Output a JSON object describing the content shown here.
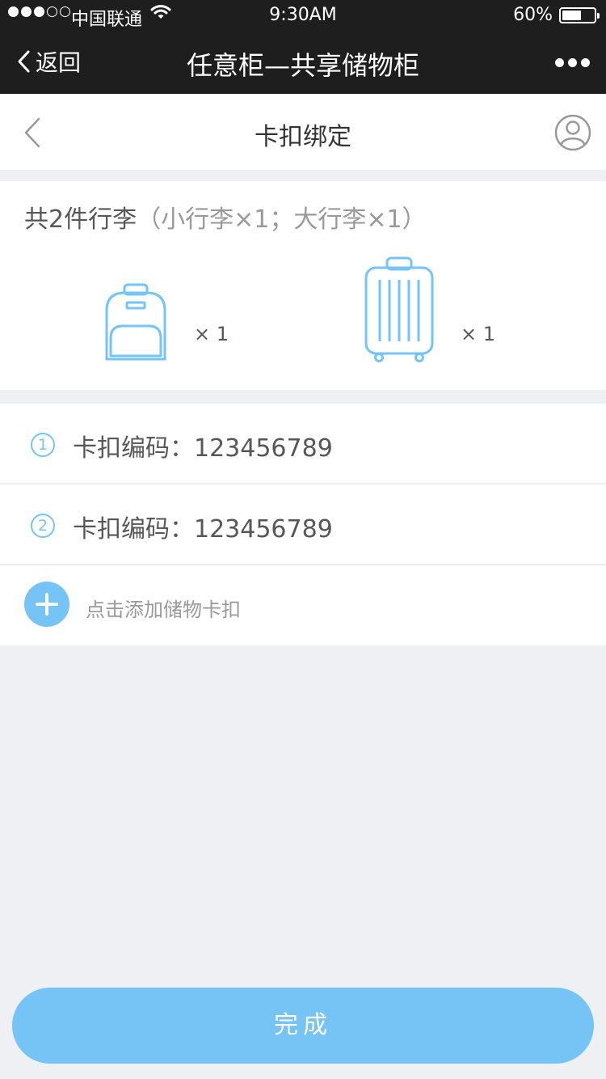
{
  "status_bar": {
    "carrier": "中国联通",
    "time": "9:30AM",
    "battery_percent_text": "60%",
    "battery_level": 0.6,
    "signal_bars_filled": 3,
    "signal_bars_total": 5
  },
  "title_bar": {
    "back_label": "返回",
    "title": "任意柜—共享储物柜"
  },
  "page_header": {
    "title": "卡扣绑定"
  },
  "luggage": {
    "summary_main": "共2件行李",
    "summary_detail": "（小行李×1；大行李×1）",
    "items": [
      {
        "icon": "backpack-icon",
        "quantity": "× 1"
      },
      {
        "icon": "suitcase-icon",
        "quantity": "× 1"
      }
    ]
  },
  "buckles": [
    {
      "index": "1",
      "label": "卡扣编码：123456789"
    },
    {
      "index": "2",
      "label": "卡扣编码：123456789"
    }
  ],
  "add_buckle": {
    "label": "点击添加储物卡扣"
  },
  "done_button": {
    "label": "完成"
  },
  "colors": {
    "accent": "#76C3F6",
    "text_primary": "#575757",
    "text_secondary": "#999999",
    "background": "#EFF0F4",
    "topbar": "#1E1E1E"
  }
}
